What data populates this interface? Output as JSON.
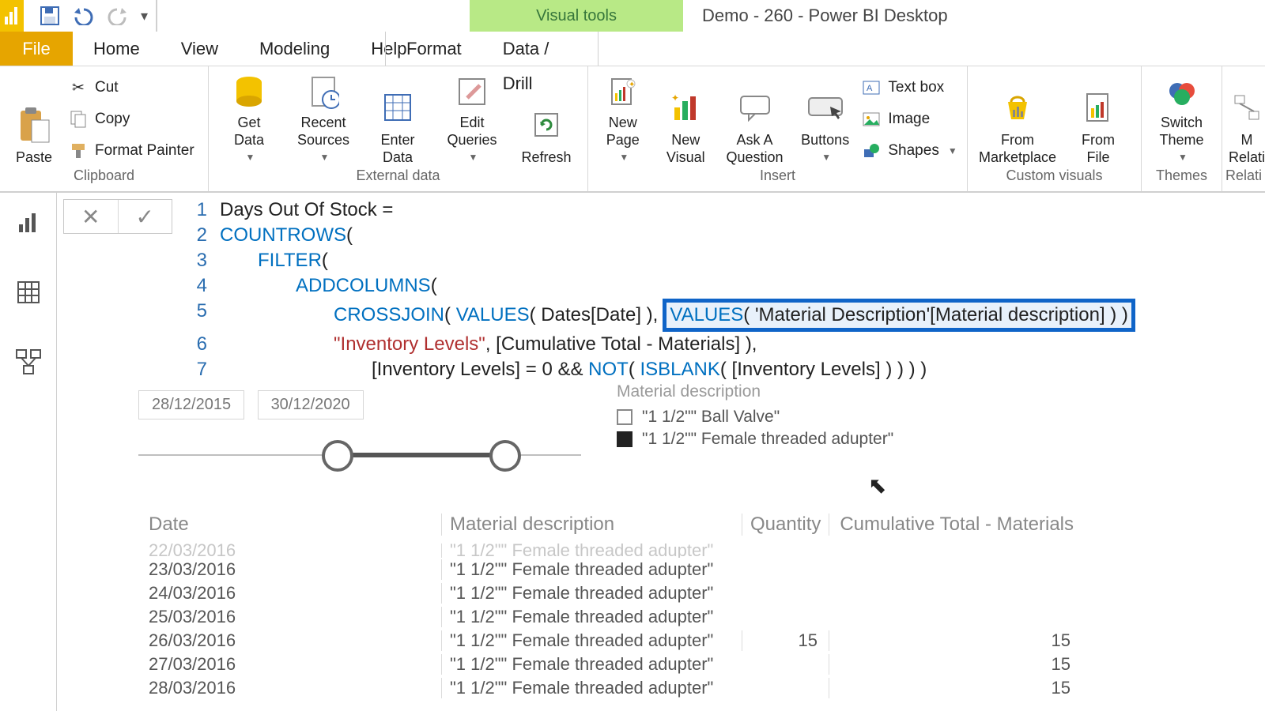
{
  "title_bar": {
    "visual_tools": "Visual tools",
    "document": "Demo - 260 - Power BI Desktop"
  },
  "tabs": {
    "file": "File",
    "home": "Home",
    "view": "View",
    "modeling": "Modeling",
    "help": "Help",
    "format": "Format",
    "data_drill": "Data / Drill"
  },
  "ribbon": {
    "clipboard": {
      "label": "Clipboard",
      "paste": "Paste",
      "cut": "Cut",
      "copy": "Copy",
      "format_painter": "Format Painter"
    },
    "external": {
      "label": "External data",
      "get": "Get\nData",
      "recent": "Recent\nSources",
      "enter": "Enter\nData",
      "edit": "Edit\nQueries",
      "refresh": "Refresh"
    },
    "insert": {
      "label": "Insert",
      "new_page": "New\nPage",
      "new_visual": "New\nVisual",
      "ask": "Ask A\nQuestion",
      "buttons": "Buttons",
      "text_box": "Text box",
      "image": "Image",
      "shapes": "Shapes"
    },
    "custom": {
      "label": "Custom visuals",
      "marketplace": "From\nMarketplace",
      "file": "From\nFile"
    },
    "themes": {
      "label": "Themes",
      "switch": "Switch\nTheme"
    },
    "relations": {
      "label": "Relati",
      "btn": "M\nRelati"
    }
  },
  "formula": {
    "l1": "Days Out Of Stock =",
    "l2_a": "COUNTROWS",
    "l2_b": "(",
    "l3_a": "FILTER",
    "l3_b": "(",
    "l4_a": "ADDCOLUMNS",
    "l4_b": "(",
    "l5_a": "CROSSJOIN",
    "l5_b": "( ",
    "l5_c": "VALUES",
    "l5_d": "( Dates[Date] ),",
    "l5_hl_a": "VALUES",
    "l5_hl_b": "( 'Material Description'[Material description] ) )",
    "l6_a": "\"Inventory Levels\"",
    "l6_b": ", [Cumulative Total - Materials] ),",
    "l7_a": "[Inventory Levels] = 0 && ",
    "l7_b": "NOT",
    "l7_c": "( ",
    "l7_d": "ISBLANK",
    "l7_e": "( [Inventory Levels] ) ) ) )"
  },
  "date_slicer": {
    "from": "28/12/2015",
    "to": "30/12/2020"
  },
  "material_slicer": {
    "header": "Material description",
    "opt1": "\"1 1/2\"\" Ball Valve\"",
    "opt2": "\"1 1/2\"\" Female threaded adupter\""
  },
  "table": {
    "cols": {
      "date": "Date",
      "mat": "Material description",
      "qty": "Quantity",
      "cum": "Cumulative Total - Materials"
    },
    "rows": [
      {
        "date": "22/03/2016",
        "mat": "\"1 1/2\"\" Female threaded adupter\"",
        "qty": "",
        "cum": ""
      },
      {
        "date": "23/03/2016",
        "mat": "\"1 1/2\"\" Female threaded adupter\"",
        "qty": "",
        "cum": ""
      },
      {
        "date": "24/03/2016",
        "mat": "\"1 1/2\"\" Female threaded adupter\"",
        "qty": "",
        "cum": ""
      },
      {
        "date": "25/03/2016",
        "mat": "\"1 1/2\"\" Female threaded adupter\"",
        "qty": "",
        "cum": ""
      },
      {
        "date": "26/03/2016",
        "mat": "\"1 1/2\"\" Female threaded adupter\"",
        "qty": "15",
        "cum": "15"
      },
      {
        "date": "27/03/2016",
        "mat": "\"1 1/2\"\" Female threaded adupter\"",
        "qty": "",
        "cum": "15"
      },
      {
        "date": "28/03/2016",
        "mat": "\"1 1/2\"\" Female threaded adupter\"",
        "qty": "",
        "cum": "15"
      }
    ]
  }
}
